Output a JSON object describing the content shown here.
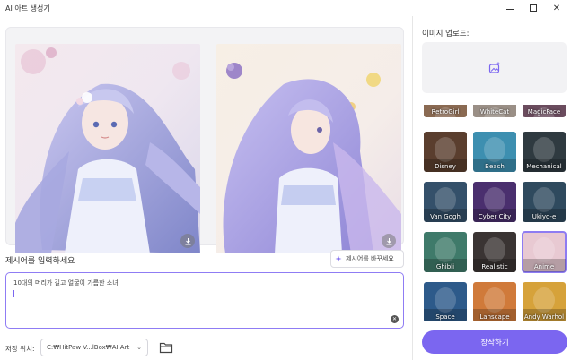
{
  "window": {
    "title": "AI 아트 생성기",
    "minimize_icon": "minimize-icon",
    "maximize_icon": "maximize-icon",
    "close_symbol": "✕"
  },
  "preview": {
    "images": [
      {
        "name": "generated-image-1",
        "download_icon": "download-icon"
      },
      {
        "name": "generated-image-2",
        "download_icon": "download-icon"
      }
    ]
  },
  "prompt": {
    "label": "제시어를 입력하세요",
    "change_button_label": "제시어를 바꾸세요",
    "text": "10대의 머리가 길고 얼굴이 가름한 소녀",
    "clear_symbol": "✕"
  },
  "save": {
    "label": "저장 위치:",
    "path": "C:₩HitPaw V...lBox₩AI Art",
    "chevron": "⌄"
  },
  "upload": {
    "label": "이미지 업로드:",
    "icon": "add-image-icon"
  },
  "styles": [
    {
      "label": "RetroGirl",
      "bg": "#8a6a52"
    },
    {
      "label": "WhiteCat",
      "bg": "#9a8f86"
    },
    {
      "label": "MagicFace",
      "bg": "#6b4c5e"
    },
    {
      "label": "Disney",
      "bg": "#5a3e2e"
    },
    {
      "label": "Beach",
      "bg": "#3d8fb0"
    },
    {
      "label": "Mechanical",
      "bg": "#2f3a40"
    },
    {
      "label": "Van Gogh",
      "bg": "#34506a"
    },
    {
      "label": "Cyber City",
      "bg": "#4a2f6e"
    },
    {
      "label": "Ukiyo-e",
      "bg": "#2f4a5e"
    },
    {
      "label": "Ghibli",
      "bg": "#3f7a6a"
    },
    {
      "label": "Realistic",
      "bg": "#3a3433"
    },
    {
      "label": "Anime",
      "bg": "#e8c9d2",
      "selected": true
    },
    {
      "label": "Space",
      "bg": "#2d5a8a"
    },
    {
      "label": "Lanscape",
      "bg": "#d07a3a"
    },
    {
      "label": "Andy Warhol",
      "bg": "#d6a23a"
    }
  ],
  "create_button_label": "창작하기",
  "colors": {
    "accent": "#7b66f0",
    "accent_border": "#8f7cf4"
  }
}
